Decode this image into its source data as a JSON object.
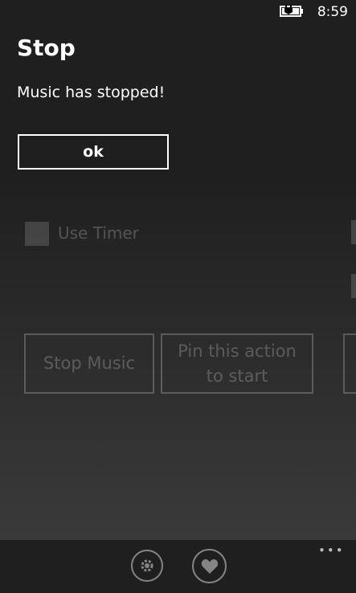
{
  "status_bar": {
    "time": "8:59",
    "battery_icon": "battery-charging-icon"
  },
  "dialog": {
    "title": "Stop",
    "message": "Music has stopped!",
    "ok_label": "ok"
  },
  "background": {
    "timer_label": "Use Timer",
    "stop_music_label": "Stop Music",
    "pin_action_label": "Pin this action to start"
  },
  "app_bar": {
    "buttons": [
      {
        "icon": "settings-icon"
      },
      {
        "icon": "heart-icon"
      }
    ],
    "more_label": "•••"
  }
}
